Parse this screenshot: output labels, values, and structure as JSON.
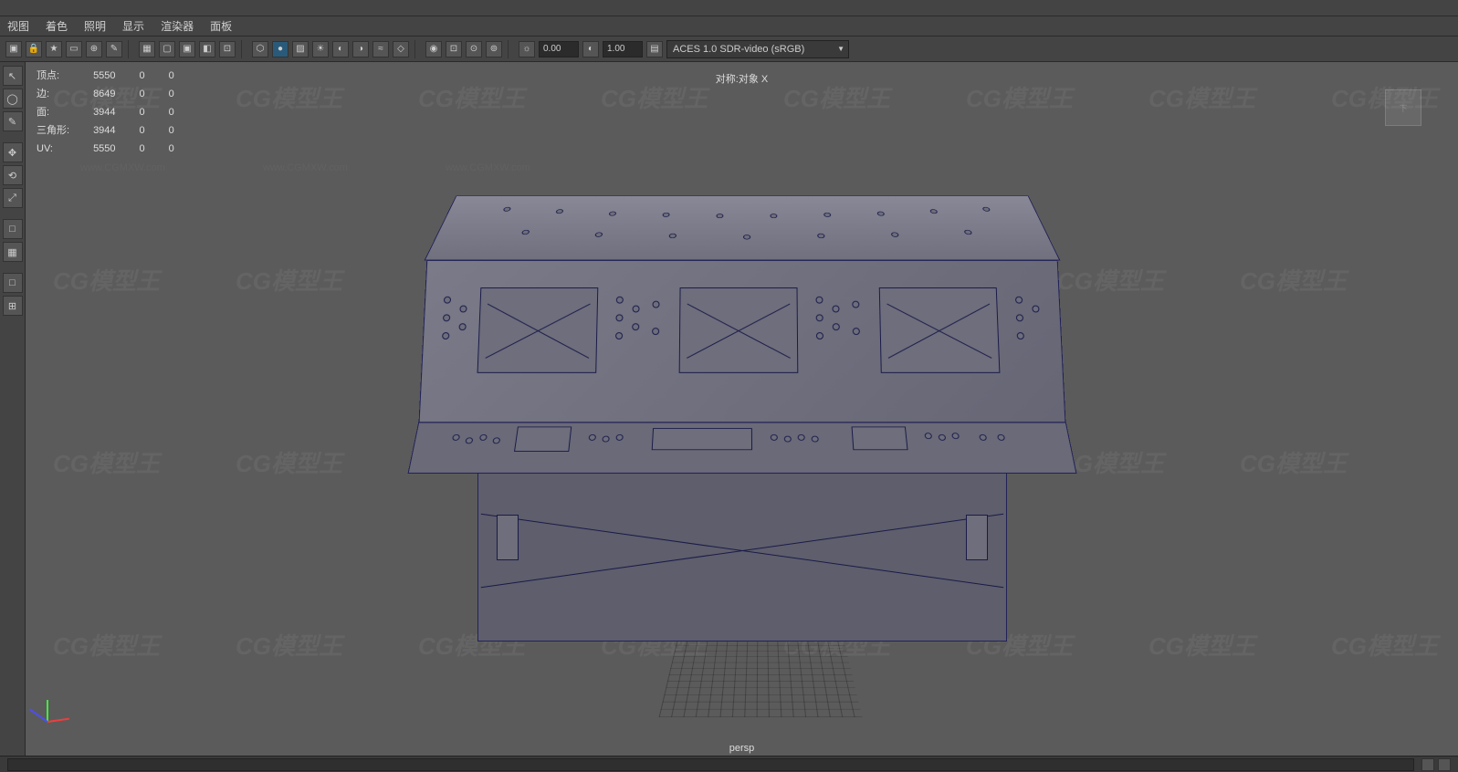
{
  "shelf": {
    "iconCount": 0
  },
  "panelMenus": {
    "items": [
      "视图",
      "着色",
      "照明",
      "显示",
      "渲染器",
      "面板"
    ]
  },
  "viewportToolbar": {
    "field1": "0.00",
    "field2": "1.00",
    "colorSpace": "ACES 1.0 SDR-video (sRGB)"
  },
  "hud": {
    "title": "对称:对象 X",
    "stats": {
      "rows": [
        {
          "label": "顶点:",
          "a": "5550",
          "b": "0",
          "c": "0"
        },
        {
          "label": "边:",
          "a": "8649",
          "b": "0",
          "c": "0"
        },
        {
          "label": "面:",
          "a": "3944",
          "b": "0",
          "c": "0"
        },
        {
          "label": "三角形:",
          "a": "3944",
          "b": "0",
          "c": "0"
        },
        {
          "label": "UV:",
          "a": "5550",
          "b": "0",
          "c": "0"
        }
      ]
    },
    "camera": "persp",
    "viewcube": "下"
  },
  "watermark": {
    "logo": "CG模型王",
    "url": "www.CGMXW.com"
  },
  "leftTools": [
    {
      "name": "select-tool",
      "icon": "↖"
    },
    {
      "name": "lasso-tool",
      "icon": "◯"
    },
    {
      "name": "paint-select-tool",
      "icon": "✎"
    },
    {
      "name": "move-tool",
      "icon": "✥"
    },
    {
      "name": "rotate-tool",
      "icon": "⟲"
    },
    {
      "name": "scale-tool",
      "icon": "⤢"
    },
    {
      "name": "sep1",
      "icon": ""
    },
    {
      "name": "last-tool",
      "icon": "□"
    },
    {
      "name": "snap-tool",
      "icon": "▦"
    },
    {
      "name": "sep2",
      "icon": ""
    },
    {
      "name": "layout-single",
      "icon": "□"
    },
    {
      "name": "layout-four",
      "icon": "⊞"
    }
  ]
}
